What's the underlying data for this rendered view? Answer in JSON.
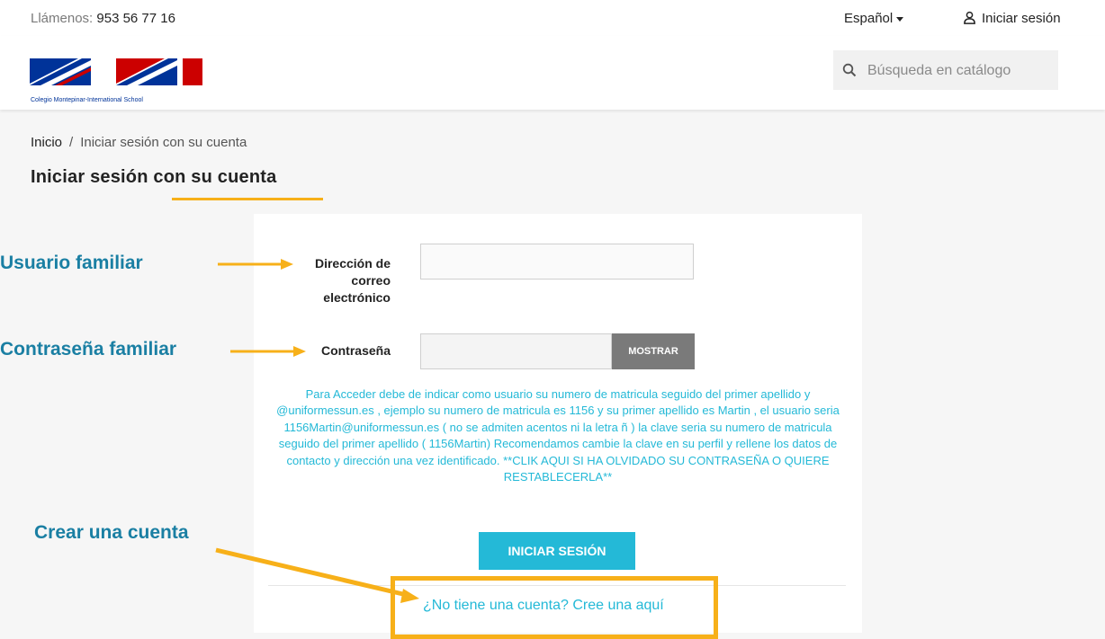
{
  "topbar": {
    "call_label": "Llámenos:",
    "phone": "953 56 77 16",
    "language": "Español",
    "signin": "Iniciar sesión"
  },
  "header": {
    "logo_caption": "Colegio Montepinar-International School",
    "search_placeholder": "Búsqueda en catálogo"
  },
  "breadcrumb": {
    "home": "Inicio",
    "separator": "/",
    "current": "Iniciar sesión con su cuenta"
  },
  "page_title": "Iniciar sesión con su cuenta",
  "form": {
    "email_label": "Dirección de correo electrónico",
    "email_value": "",
    "password_label": "Contraseña",
    "password_value": "",
    "show_label": "MOSTRAR",
    "help_text": "Para Acceder debe de indicar como usuario su numero de matricula seguido del primer apellido y @uniformessun.es , ejemplo su numero de matricula es 1156 y su primer apellido es Martin , el usuario seria 1156Martin@uniformessun.es ( no se admiten acentos ni la letra ñ ) la clave seria su numero de matricula seguido del primer apellido ( 1156Martin) Recomendamos cambie la clave en su perfil y rellene los datos de contacto y dirección una vez identificado. **CLIK AQUI SI HA OLVIDADO SU CONTRASEÑA O QUIERE RESTABLECERLA**",
    "login_button": "INICIAR SESIÓN",
    "create_account": "¿No tiene una cuenta? Cree una aquí"
  },
  "annotations": {
    "user": "Usuario familiar",
    "password": "Contraseña familiar",
    "create": "Crear una cuenta"
  },
  "colors": {
    "accent": "#24b9d7",
    "highlight": "#f7b019",
    "annotation_text": "#1a7fa3"
  }
}
